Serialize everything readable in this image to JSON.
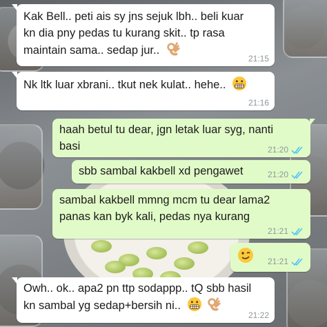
{
  "chat": {
    "messages": [
      {
        "id": "m1",
        "direction": "incoming",
        "text": "Kak Bell.. peti ais sy jns sejuk lbh.. beli kuar\nkn dia pny pedas tu kurang skit.. tp rasa\nmaintain sama.. sedap jur..",
        "emoji": [
          "ok-hand"
        ],
        "time": "21:15"
      },
      {
        "id": "m2",
        "direction": "incoming",
        "text": "Nk ltk luar xbrani.. tkut nek kulat.. hehe..",
        "emoji": [
          "grimace"
        ],
        "time": "21:16"
      },
      {
        "id": "m3",
        "direction": "outgoing",
        "text": "haah betul tu dear, jgn letak luar syg, nanti\nbasi",
        "emoji": [],
        "time": "21:20",
        "status": "read"
      },
      {
        "id": "m4",
        "direction": "outgoing",
        "text": "sbb sambal kakbell xd pengawet",
        "emoji": [],
        "time": "21:20",
        "status": "read"
      },
      {
        "id": "m5",
        "direction": "outgoing",
        "text": "sambal kakbell mmng mcm tu dear lama2\npanas kan byk kali, pedas nya kurang",
        "emoji": [],
        "time": "21:21",
        "status": "read"
      },
      {
        "id": "m6",
        "direction": "outgoing",
        "text": "",
        "emoji": [
          "wink"
        ],
        "time": "21:21",
        "status": "read"
      },
      {
        "id": "m7",
        "direction": "incoming",
        "text": "Owh.. ok.. apa2 pn ttp sodappp.. tQ sbb hasil\nkn sambal yg sedap+bersih ni..",
        "emoji": [
          "grimace",
          "ok-hand"
        ],
        "time": "21:22"
      }
    ],
    "colors": {
      "incoming_bubble": "#ffffff",
      "outgoing_bubble": "#e1fbc8",
      "read_ticks": "#4fc3f7",
      "timestamp": "#8f969a"
    }
  }
}
